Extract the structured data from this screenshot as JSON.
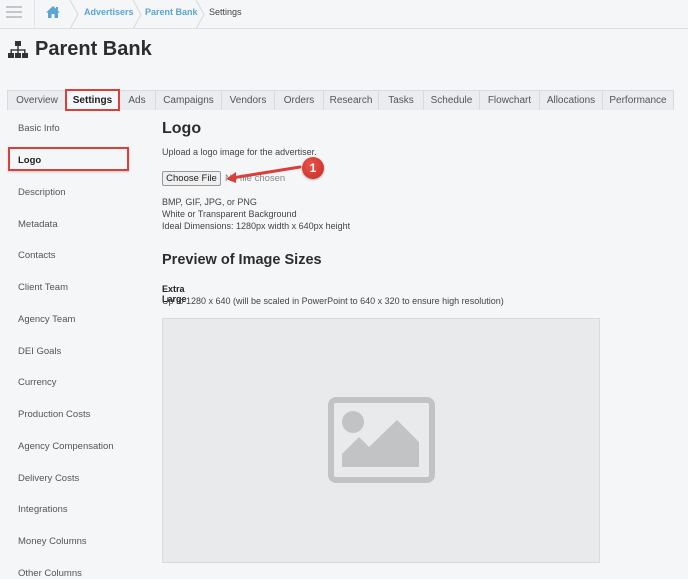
{
  "breadcrumb": {
    "home_icon": "home-icon",
    "items": [
      {
        "label": "Advertisers",
        "link": true
      },
      {
        "label": "Parent Bank",
        "link": true
      },
      {
        "label": "Settings",
        "link": false
      }
    ]
  },
  "page": {
    "title": "Parent Bank",
    "title_icon": "org-chart-icon"
  },
  "tabs": [
    {
      "label": "Overview",
      "active": false
    },
    {
      "label": "Settings",
      "active": true
    },
    {
      "label": "Ads",
      "active": false
    },
    {
      "label": "Campaigns",
      "active": false
    },
    {
      "label": "Vendors",
      "active": false
    },
    {
      "label": "Orders",
      "active": false
    },
    {
      "label": "Research",
      "active": false
    },
    {
      "label": "Tasks",
      "active": false
    },
    {
      "label": "Schedule",
      "active": false
    },
    {
      "label": "Flowchart",
      "active": false
    },
    {
      "label": "Allocations",
      "active": false
    },
    {
      "label": "Performance",
      "active": false
    }
  ],
  "sidebar": {
    "items": [
      {
        "label": "Basic Info",
        "active": false
      },
      {
        "label": "Logo",
        "active": true
      },
      {
        "label": "Description",
        "active": false
      },
      {
        "label": "Metadata",
        "active": false
      },
      {
        "label": "Contacts",
        "active": false
      },
      {
        "label": "Client Team",
        "active": false
      },
      {
        "label": "Agency Team",
        "active": false
      },
      {
        "label": "DEI Goals",
        "active": false
      },
      {
        "label": "Currency",
        "active": false
      },
      {
        "label": "Production Costs",
        "active": false
      },
      {
        "label": "Agency Compensation",
        "active": false
      },
      {
        "label": "Delivery Costs",
        "active": false
      },
      {
        "label": "Integrations",
        "active": false
      },
      {
        "label": "Money Columns",
        "active": false
      },
      {
        "label": "Other Columns",
        "active": false
      }
    ]
  },
  "logo_section": {
    "heading": "Logo",
    "description": "Upload a logo image for the advertiser.",
    "choose_file_label": "Choose File",
    "file_status": "No file chosen",
    "specs": [
      "BMP, GIF, JPG, or PNG",
      "White or Transparent Background",
      "Ideal Dimensions: 1280px width x 640px height"
    ]
  },
  "preview_section": {
    "heading": "Preview of Image Sizes",
    "size_label": "Extra Large",
    "size_description": "Up to 1280 x 640 (will be scaled in PowerPoint to 640 x 320 to ensure high resolution)",
    "placeholder_icon": "image-placeholder-icon"
  },
  "annotation": {
    "step_number": "1",
    "color": "#d9403a"
  }
}
